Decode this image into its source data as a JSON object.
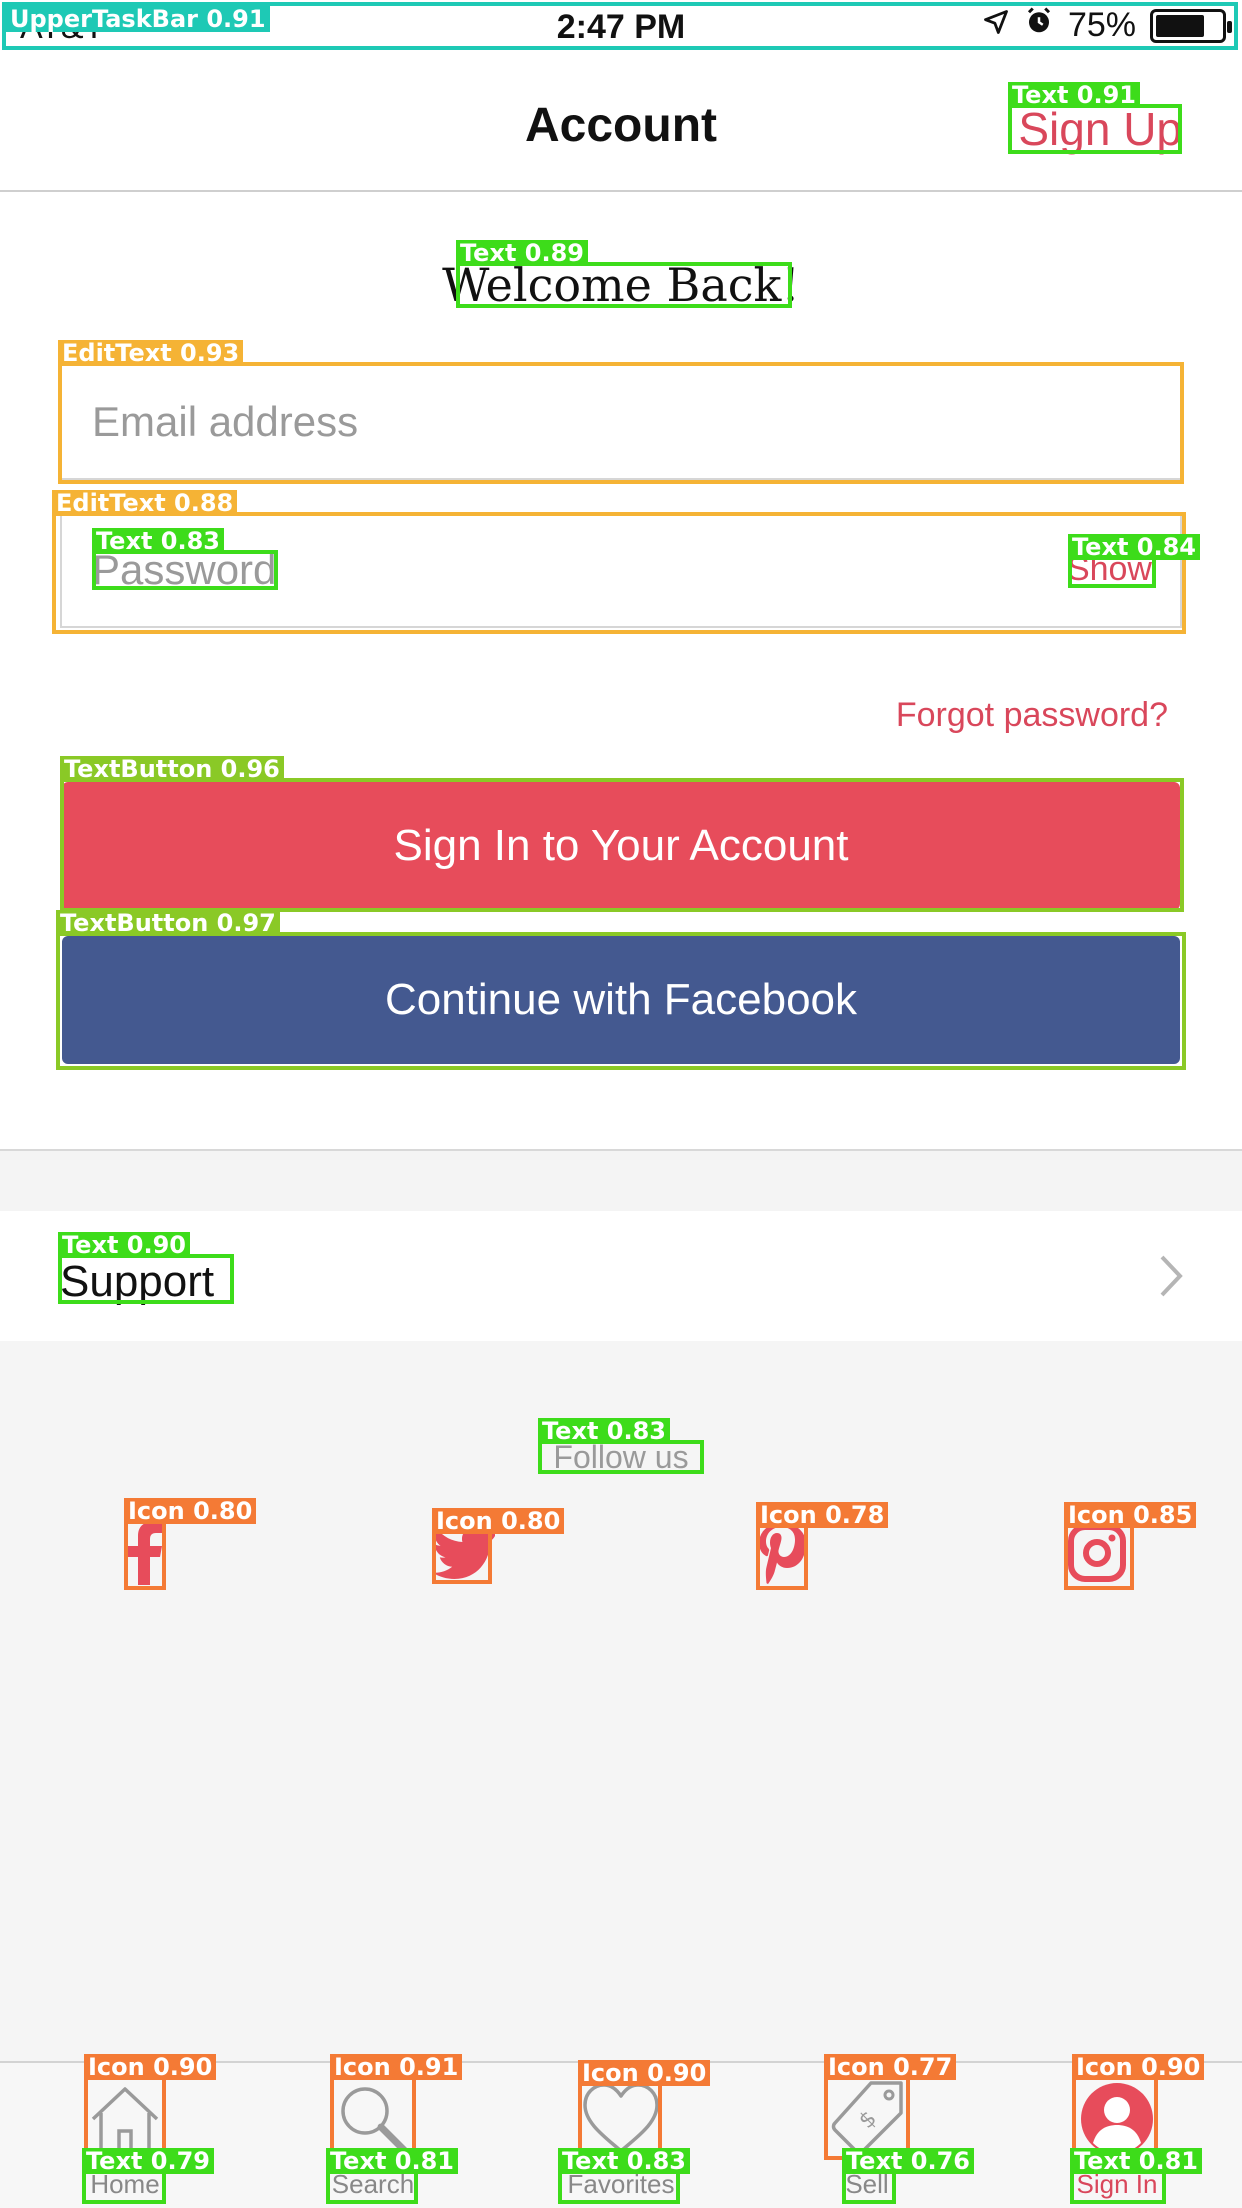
{
  "status_bar": {
    "carrier": "AT&T",
    "time": "2:47 PM",
    "battery": "75%",
    "battery_level": 0.75
  },
  "header": {
    "title": "Account",
    "sign_up": "Sign Up"
  },
  "form": {
    "welcome": "Welcome Back!",
    "email_placeholder": "Email address",
    "password_placeholder": "Password",
    "show_label": "Show",
    "forgot_label": "Forgot password?",
    "signin_label": "Sign In to Your Account",
    "facebook_label": "Continue with Facebook"
  },
  "support": {
    "label": "Support"
  },
  "follow": {
    "label": "Follow us",
    "icons": [
      "facebook-icon",
      "twitter-icon",
      "pinterest-icon",
      "instagram-icon"
    ]
  },
  "tabs": [
    {
      "label": "Home",
      "icon": "home-icon"
    },
    {
      "label": "Search",
      "icon": "search-icon"
    },
    {
      "label": "Favorites",
      "icon": "heart-icon"
    },
    {
      "label": "Sell",
      "icon": "tag-icon"
    },
    {
      "label": "Sign In",
      "icon": "user-icon"
    }
  ],
  "annotations": {
    "upper_task_bar": "UpperTaskBar 0.91",
    "text_signup": "Text 0.91",
    "text_welcome": "Text 0.89",
    "edit_email": "EditText 0.93",
    "edit_password": "EditText 0.88",
    "text_password": "Text 0.83",
    "text_show": "Text 0.84",
    "btn_signin": "TextButton 0.96",
    "btn_facebook": "TextButton 0.97",
    "text_support": "Text 0.90",
    "text_follow": "Text 0.83",
    "icon_facebook": "Icon 0.80",
    "icon_twitter": "Icon 0.80",
    "icon_pinterest": "Icon 0.78",
    "icon_instagram": "Icon 0.85",
    "icon_home": "Icon 0.90",
    "icon_search": "Icon 0.91",
    "icon_favorites": "Icon 0.90",
    "icon_sell": "Icon 0.77",
    "icon_signin": "Icon 0.90",
    "text_home": "Text 0.79",
    "text_search": "Text 0.81",
    "text_favorites": "Text 0.83",
    "text_sell": "Text 0.76",
    "text_signin": "Text 0.81"
  },
  "colors": {
    "accent": "#d9475b",
    "signin_button": "#e74c5b",
    "facebook_button": "#445990"
  }
}
